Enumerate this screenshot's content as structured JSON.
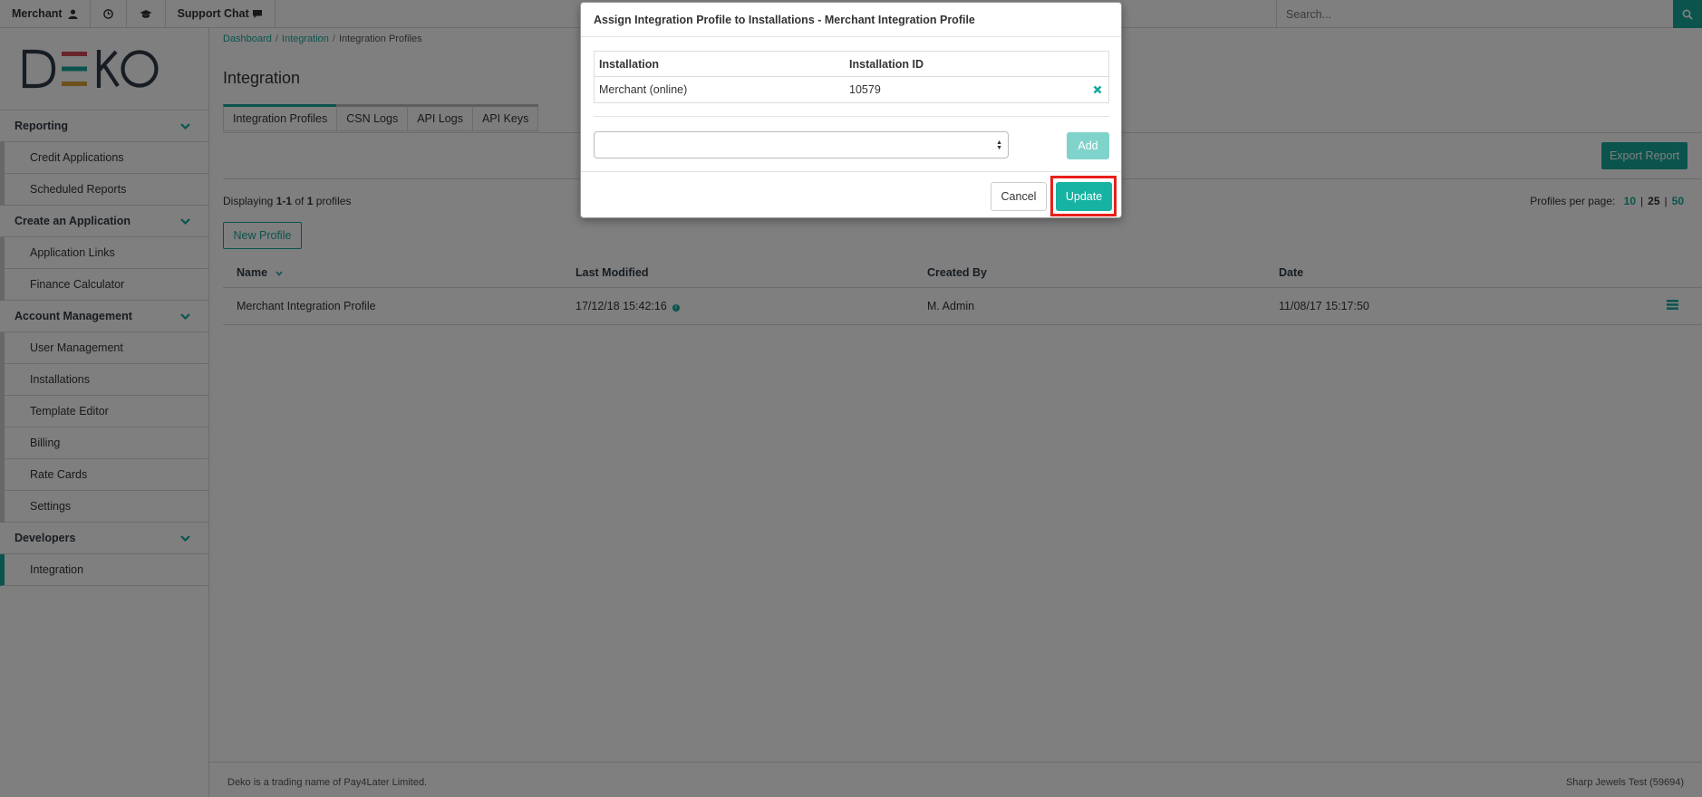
{
  "topbar": {
    "merchant_label": "Merchant",
    "support_label": "Support Chat",
    "search_placeholder": "Search..."
  },
  "sidebar": {
    "logo": "DEKO",
    "sections": [
      {
        "title": "Reporting",
        "items": [
          "Credit Applications",
          "Scheduled Reports"
        ]
      },
      {
        "title": "Create an Application",
        "items": [
          "Application Links",
          "Finance Calculator"
        ]
      },
      {
        "title": "Account Management",
        "items": [
          "User Management",
          "Installations",
          "Template Editor",
          "Billing",
          "Rate Cards",
          "Settings"
        ]
      },
      {
        "title": "Developers",
        "items": [
          "Integration"
        ]
      }
    ]
  },
  "breadcrumb": {
    "home": "Dashboard",
    "parent": "Integration",
    "current": "Integration Profiles"
  },
  "page_title": "Integration",
  "tabs": [
    "Integration Profiles",
    "CSN Logs",
    "API Logs",
    "API Keys"
  ],
  "export_label": "Export Report",
  "displaying": {
    "prefix": "Displaying ",
    "range": "1-1",
    "of": " of ",
    "total": "1",
    "suffix": " profiles"
  },
  "per_page": {
    "label": "Profiles per page:",
    "options": [
      "10",
      "25",
      "50"
    ]
  },
  "new_profile_label": "New Profile",
  "table": {
    "headers": [
      "Name",
      "Last Modified",
      "Created By",
      "Date"
    ],
    "rows": [
      {
        "name": "Merchant Integration Profile",
        "modified": "17/12/18 15:42:16",
        "created_by": "M. Admin",
        "date": "11/08/17 15:17:50"
      }
    ]
  },
  "footer": {
    "left": "Deko is a trading name of Pay4Later Limited.",
    "right": "Sharp Jewels Test (59694)"
  },
  "modal": {
    "title": "Assign Integration Profile to Installations - Merchant Integration Profile",
    "headers": [
      "Installation",
      "Installation ID"
    ],
    "rows": [
      {
        "installation": "Merchant (online)",
        "id": "10579"
      }
    ],
    "add_label": "Add",
    "cancel_label": "Cancel",
    "update_label": "Update",
    "highlight_color": "#e8201a"
  },
  "colors": {
    "accent": "#16a89a"
  }
}
